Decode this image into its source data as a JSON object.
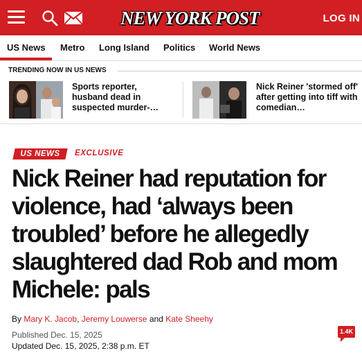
{
  "header": {
    "logo": "NEW YORK POST",
    "login_label": "LOG IN",
    "icons": [
      "hamburger-menu-icon",
      "search-icon",
      "mail-icon"
    ],
    "brand_color": "#d11f23"
  },
  "nav": {
    "items": [
      {
        "label": "US News"
      },
      {
        "label": "Metro"
      },
      {
        "label": "Long Island"
      },
      {
        "label": "Politics"
      },
      {
        "label": "World News"
      }
    ]
  },
  "trending": {
    "heading": "TRENDING NOW IN US NEWS",
    "items": [
      {
        "title": "Sports reporter, husband dead in suspected murder-…"
      },
      {
        "title": "Nick Reiner 'stormed off' after getting into tiff with comedian…"
      }
    ]
  },
  "article": {
    "section_tag": "US NEWS",
    "label": "EXCLUSIVE",
    "headline": "Nick Reiner had reputation for violence, had ‘always been troubled’ before he allegedly slaughtered dad Rob and mom Michele: pals",
    "byline": {
      "by": "By",
      "authors": [
        "Mary K. Jacob",
        "Jeremy Louwerse",
        "Kate Sheehy"
      ],
      "separator": ",",
      "and": "and"
    },
    "published_label": "Published",
    "published_date": "Dec. 15, 2025",
    "updated_label": "Updated",
    "updated_date": "Dec. 15, 2025, 2:38 p.m. ET",
    "comment_count": "1.4K"
  }
}
